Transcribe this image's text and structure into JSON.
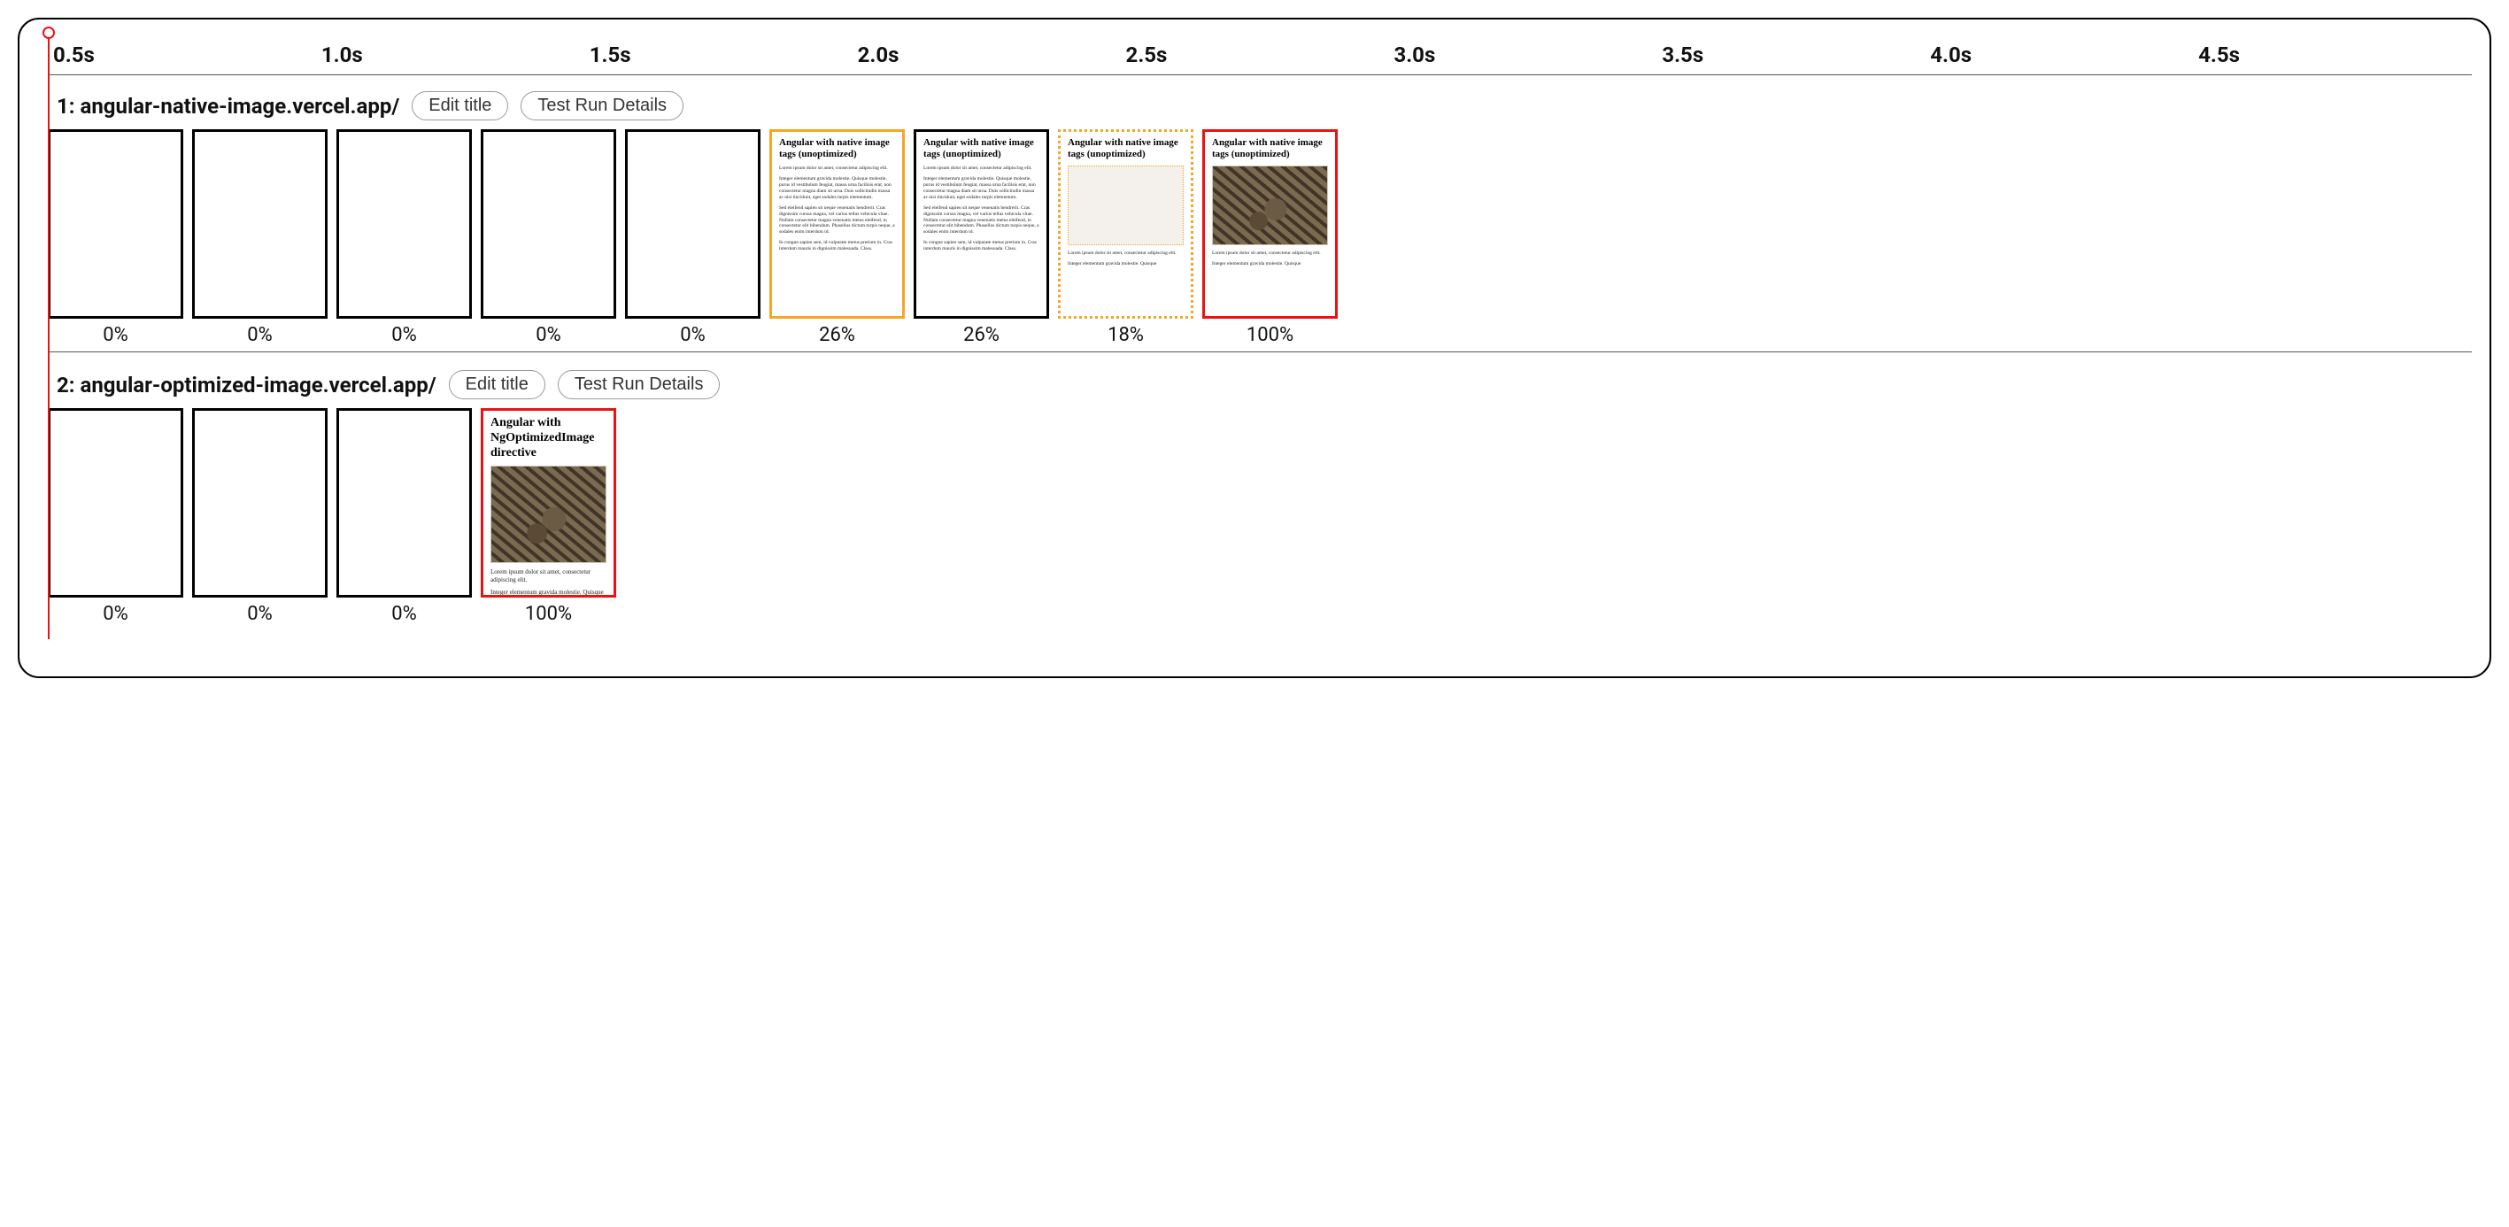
{
  "timeline": {
    "ticks": [
      "0.5s",
      "1.0s",
      "1.5s",
      "2.0s",
      "2.5s",
      "3.0s",
      "3.5s",
      "4.0s",
      "4.5s"
    ]
  },
  "buttons": {
    "edit_title": "Edit title",
    "test_run_details": "Test Run Details"
  },
  "thumbnails": {
    "native_title": "Angular with native image tags (unoptimized)",
    "optimized_title": "Angular with NgOptimizedImage directive",
    "lorem1": "Lorem ipsum dolor sit amet, consectetur adipiscing elit.",
    "lorem2": "Integer elementum gravida molestie. Quisque molestie, purus id vestibulum feugiat, massa urna facilisis erat, non consectetur magna diam sit urna. Duis sollicitudin massa ac nisi tincidunt, eget sodales turpis elementum.",
    "lorem3": "Sed eleifend sapien sit neque venenatis hendrerit. Cras dignissim cursus magna, vel varius tellus vehicula vitae. Nullam consectetur magna venenatis metus eleifend, in consectetur elit bibendum. Phasellus dictum turpis neque, a sodales enim interdum id.",
    "lorem4": "In congue sapien sem, id vulputate metus pretium in. Cras interdum mauris in dignissim malesuada. Class.",
    "lorem_short2": "Integer elementum gravida molestie. Quisque"
  },
  "runs": [
    {
      "label": "1: angular-native-image.vercel.app/",
      "frames": [
        {
          "pct": "0%",
          "style": "blank"
        },
        {
          "pct": "0%",
          "style": "blank"
        },
        {
          "pct": "0%",
          "style": "blank"
        },
        {
          "pct": "0%",
          "style": "blank"
        },
        {
          "pct": "0%",
          "style": "blank"
        },
        {
          "pct": "26%",
          "style": "orange",
          "content": "text"
        },
        {
          "pct": "26%",
          "style": "default",
          "content": "text"
        },
        {
          "pct": "18%",
          "style": "orange-dotted",
          "content": "text-flatimg"
        },
        {
          "pct": "100%",
          "style": "red",
          "content": "text-img"
        }
      ]
    },
    {
      "label": "2: angular-optimized-image.vercel.app/",
      "frames": [
        {
          "pct": "0%",
          "style": "blank"
        },
        {
          "pct": "0%",
          "style": "blank"
        },
        {
          "pct": "0%",
          "style": "blank"
        },
        {
          "pct": "100%",
          "style": "red",
          "content": "opt-img"
        }
      ]
    }
  ]
}
